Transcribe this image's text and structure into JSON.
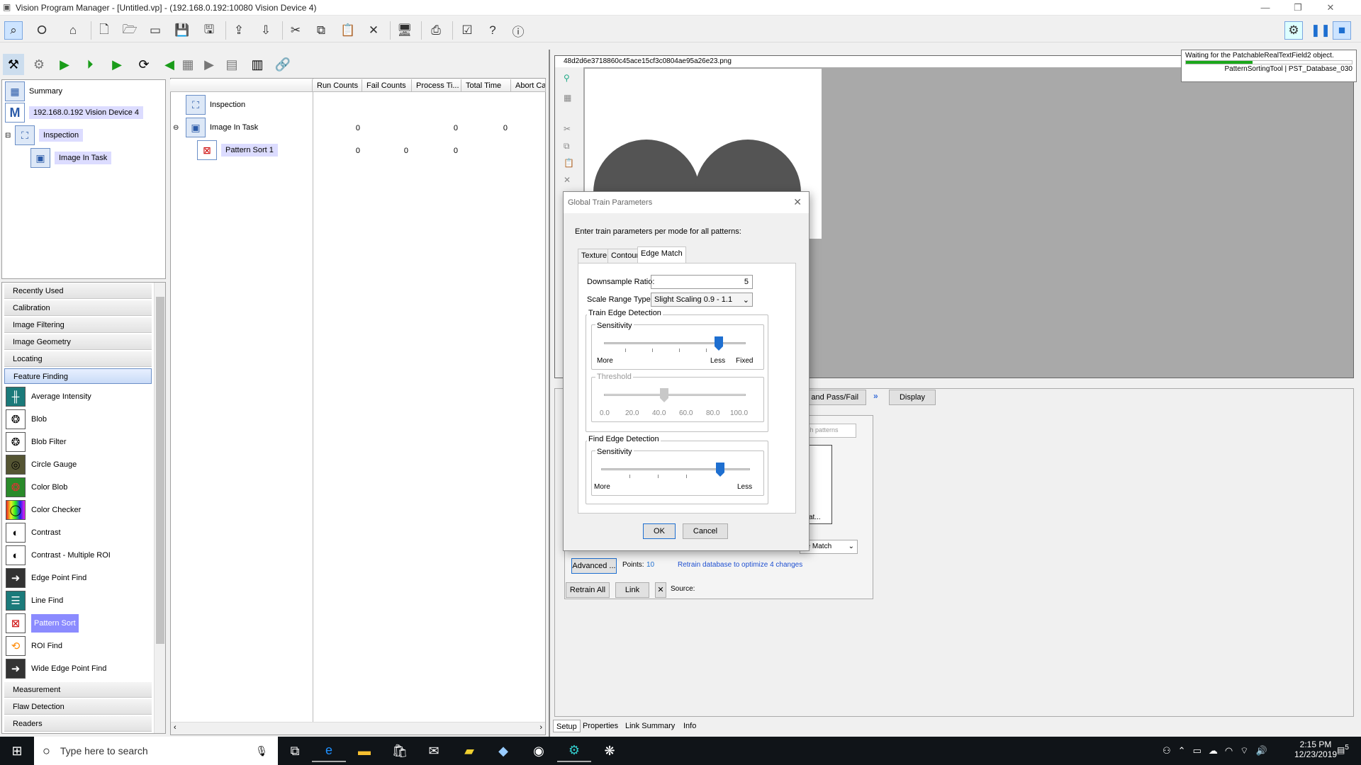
{
  "window": {
    "title": "Vision Program Manager - [Untitled.vp] - (192.168.0.192:10080 Vision Device 4)"
  },
  "tree": {
    "items": [
      "Summary",
      "192.168.0.192 Vision Device 4",
      "Inspection",
      "Image In Task"
    ]
  },
  "task_tree": {
    "items": [
      "Inspection",
      "Image In Task",
      "Pattern Sort 1"
    ]
  },
  "grid": {
    "columns": [
      "Run Counts",
      "Fail Counts",
      "Process Ti...",
      "Total Time",
      "Abort Ca"
    ],
    "rows": [
      [
        "",
        "",
        "",
        "",
        ""
      ],
      [
        "0",
        "",
        "0",
        "0",
        ""
      ],
      [
        "0",
        "0",
        "0",
        "",
        ""
      ]
    ]
  },
  "categories": {
    "top": [
      "Recently Used",
      "Calibration",
      "Image Filtering",
      "Image Geometry",
      "Locating",
      "Feature Finding"
    ],
    "bottom": [
      "Measurement",
      "Flaw Detection",
      "Readers"
    ]
  },
  "tools": [
    "Average Intensity",
    "Blob",
    "Blob Filter",
    "Circle Gauge",
    "Color Blob",
    "Color Checker",
    "Contrast",
    "Contrast - Multiple ROI",
    "Edge Point Find",
    "Line Find",
    "Pattern Sort",
    "ROI Find",
    "Wide Edge Point Find"
  ],
  "image_panel": {
    "filename": "48d2d6e3718860c45ace15cf3c0804ae95a26e23.png"
  },
  "tooltip": {
    "line1": "Waiting for the PatchableRealTextField2 object.",
    "line2": "PatternSortingTool | PST_Database_030",
    "progress": 0.4
  },
  "dialog": {
    "title": "Global Train Parameters",
    "instruction": "Enter train parameters per mode for all patterns:",
    "tabs": [
      "Texture",
      "Contour",
      "Edge Match"
    ],
    "downsample_label": "Downsample Ratio:",
    "downsample_value": "5",
    "scale_label": "Scale Range Type:",
    "scale_value": "Slight Scaling 0.9 - 1.1",
    "train_group": "Train Edge Detection",
    "sensitivity": "Sensitivity",
    "more": "More",
    "less": "Less",
    "fixed": "Fixed",
    "threshold": "Threshold",
    "threshold_ticks": [
      "0.0",
      "20.0",
      "40.0",
      "60.0",
      "80.0",
      "100.0"
    ],
    "find_group": "Find Edge Detection",
    "ok": "OK",
    "cancel": "Cancel"
  },
  "behind": {
    "pass_fail": "l and Pass/Fail",
    "display": "Display",
    "search_ph": "ch patterns",
    "edge_match": "ge Match",
    "at": "at...",
    "advanced": "Advanced ...",
    "points_label": "Points:",
    "points_value": "10",
    "retrain_link": "Retrain database to optimize 4 changes",
    "retrain_all": "Retrain All",
    "link": "Link",
    "source": "Source:"
  },
  "bottom_tabs": [
    "Setup",
    "Properties",
    "Link Summary",
    "Info"
  ],
  "taskbar": {
    "search_placeholder": "Type here to search",
    "time": "2:15 PM",
    "date": "12/23/2019",
    "notifications": "5"
  }
}
